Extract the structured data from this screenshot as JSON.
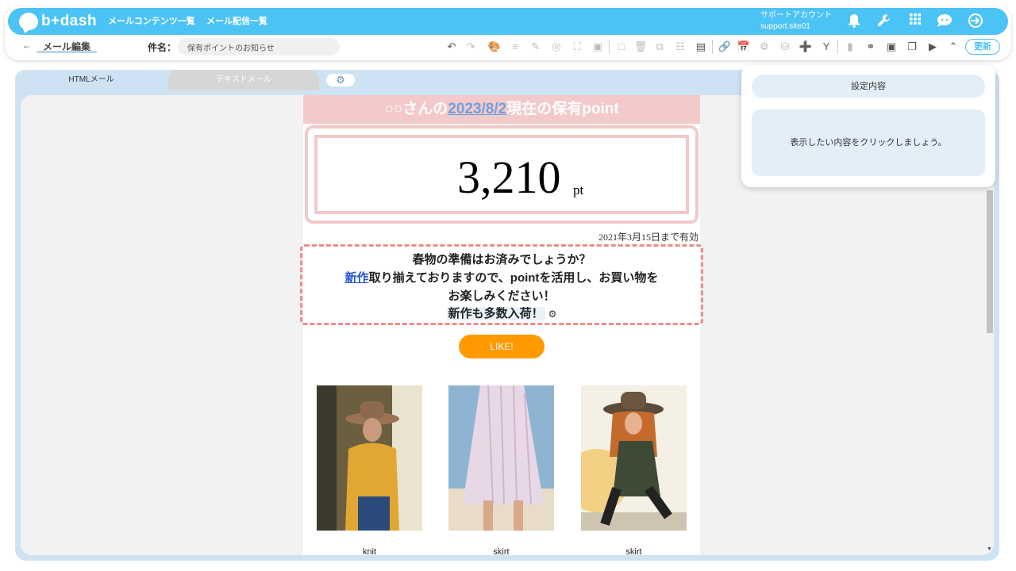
{
  "header": {
    "logo_text": "b+dash",
    "nav": [
      "メールコンテンツ一覧",
      "メール配信一覧"
    ],
    "account_label": "サポートアカウント",
    "account_id": "support.site01"
  },
  "toolbar": {
    "back_title": "メール編集",
    "subject_label": "件名：",
    "subject_value": "保有ポイントのお知らせ",
    "update_label": "更新"
  },
  "tabs": {
    "html": "HTMLメール",
    "text": "テキストメール"
  },
  "email": {
    "headline_prefix": "○○さんの",
    "headline_date": "2023/8/2",
    "headline_suffix": "現在の保有point",
    "points": "3,210",
    "points_unit": "pt",
    "expiry": "2021年3月15日まで有効",
    "message_line1": "春物の準備はお済みでしょうか？",
    "message_link": "新作",
    "message_line2_rest": "取り揃えておりますので、pointを活用し、お買い物を",
    "message_line3": "お楽しみください！",
    "message_line4": "新作も多数入荷！",
    "like_label": "LIKE!",
    "products": [
      {
        "label": "knit"
      },
      {
        "label": "skirt"
      },
      {
        "label": "skirt"
      }
    ]
  },
  "panel": {
    "title": "設定内容",
    "body": "表示したい内容をクリックしましょう。"
  },
  "colors": {
    "brand": "#4cc3f5",
    "accent_pink": "#f3c9c9",
    "dashed_border": "#f08a8a",
    "like_button": "#ff9900"
  }
}
